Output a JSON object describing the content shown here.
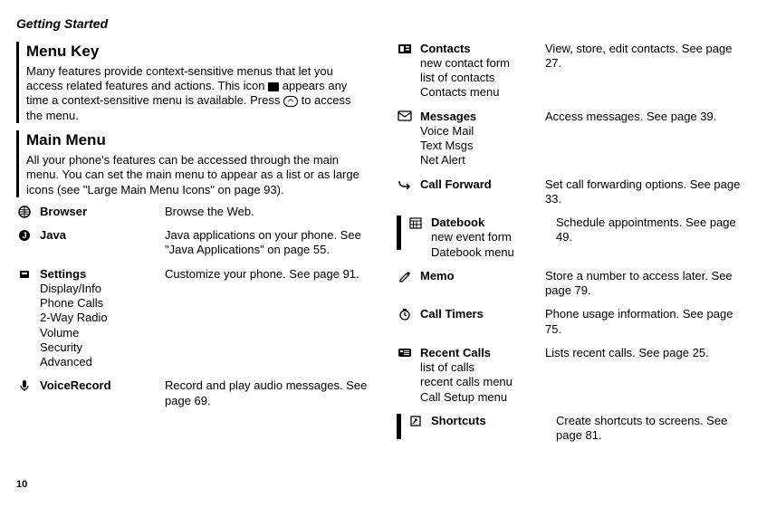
{
  "header": "Getting Started",
  "menuKey": {
    "title": "Menu Key",
    "body_pre": "Many features provide context-sensitive menus that let you access related features and actions. This icon ",
    "body_mid": " appears any time a context-sensitive menu is available. Press ",
    "body_post": " to access the menu."
  },
  "mainMenu": {
    "title": "Main Menu",
    "body": "All your phone's features can be accessed through the main menu. You can set the main menu to appear as a list or as large icons (see \"Large Main Menu Icons\" on page 93)."
  },
  "left": [
    {
      "name": "Browser",
      "sub": [],
      "desc": "Browse the Web."
    },
    {
      "name": "Java",
      "sub": [],
      "desc": "Java applications on your phone. See \"Java Applications\" on page 55."
    },
    {
      "name": "Settings",
      "sub": [
        "Display/Info",
        "Phone Calls",
        "2-Way Radio",
        "Volume",
        "Security",
        "Advanced"
      ],
      "desc": "Customize your phone. See page 91."
    },
    {
      "name": "VoiceRecord",
      "sub": [],
      "desc": "Record and play audio messages. See page 69."
    }
  ],
  "right": [
    {
      "name": "Contacts",
      "sub": [
        "new contact form",
        "list of contacts",
        "Contacts menu"
      ],
      "desc": "View, store, edit contacts. See page 27."
    },
    {
      "name": "Messages",
      "sub": [
        "Voice Mail",
        "Text Msgs",
        "Net Alert"
      ],
      "desc": "Access messages. See page 39."
    },
    {
      "name": "Call Forward",
      "sub": [],
      "desc": "Set call forwarding options. See page 33."
    },
    {
      "name": "Datebook",
      "sub": [
        "new event form",
        "Datebook menu"
      ],
      "desc": "Schedule appointments. See page 49.",
      "divider": true
    },
    {
      "name": "Memo",
      "sub": [],
      "desc": "Store a number to access later. See page 79."
    },
    {
      "name": "Call Timers",
      "sub": [],
      "desc": "Phone usage information. See page 75."
    },
    {
      "name": "Recent Calls",
      "sub": [
        "list of calls",
        "recent calls menu",
        "Call Setup menu"
      ],
      "desc": "Lists recent calls. See page 25."
    },
    {
      "name": "Shortcuts",
      "sub": [],
      "desc": "Create shortcuts to screens. See page 81.",
      "divider": true
    }
  ],
  "icons": {
    "browser": "✿",
    "java": "⊘",
    "settings": "⌂",
    "voicerecord": "✎",
    "contacts": "☎",
    "messages": "✉",
    "callforward": "↪",
    "datebook": "▦",
    "memo": "✎",
    "calltimers": "⏱",
    "recentcalls": "☏",
    "shortcuts": "⇶"
  },
  "pageNumber": "10"
}
